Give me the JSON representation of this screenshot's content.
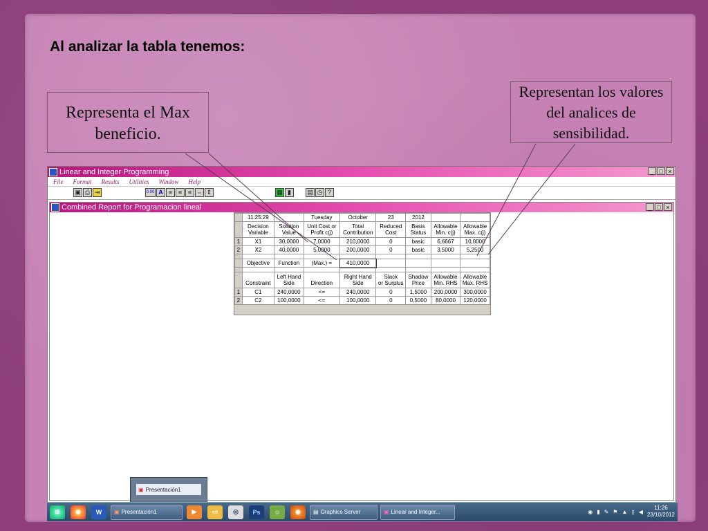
{
  "slide": {
    "title": "Al analizar la tabla tenemos:",
    "callout_left": "Representa el Max beneficio.",
    "callout_right": "Representan los valores del analices de sensibilidad."
  },
  "app": {
    "title": "Linear and Integer Programming",
    "menu": [
      "File",
      "Format",
      "Results",
      "Utilities",
      "Window",
      "Help"
    ],
    "toolbar": {
      "decimal_label": "0.00",
      "font_label": "A"
    },
    "child_title": "Combined Report for Programacion lineal"
  },
  "report": {
    "header_row": [
      "11:25:29",
      "",
      "Tuesday",
      "October",
      "23",
      "2012",
      "",
      ""
    ],
    "col_headers": [
      [
        "Decision",
        "Variable"
      ],
      [
        "Solution",
        "Value"
      ],
      [
        "Unit Cost or",
        "Profit c(j)"
      ],
      [
        "Total",
        "Contribution"
      ],
      [
        "Reduced",
        "Cost"
      ],
      [
        "Basis",
        "Status"
      ],
      [
        "Allowable",
        "Min. c(j)"
      ],
      [
        "Allowable",
        "Max. c(j)"
      ]
    ],
    "var_rows": [
      {
        "idx": "1",
        "cells": [
          "X1",
          "30,0000",
          "7,0000",
          "210,0000",
          "0",
          "basic",
          "6,6667",
          "10,0000"
        ]
      },
      {
        "idx": "2",
        "cells": [
          "X2",
          "40,0000",
          "5,0000",
          "200,0000",
          "0",
          "basic",
          "3,5000",
          "5,2500"
        ]
      }
    ],
    "objective_row": [
      "Objective",
      "Function",
      "(Max.) =",
      "410,0000"
    ],
    "con_headers": [
      [
        "",
        "Constraint"
      ],
      [
        "Left Hand",
        "Side"
      ],
      [
        "",
        "Direction"
      ],
      [
        "Right Hand",
        "Side"
      ],
      [
        "Slack",
        "or Surplus"
      ],
      [
        "Shadow",
        "Price"
      ],
      [
        "Allowable",
        "Min. RHS"
      ],
      [
        "Allowable",
        "Max. RHS"
      ]
    ],
    "con_rows": [
      {
        "idx": "1",
        "cells": [
          "C1",
          "240,0000",
          "<=",
          "240,0000",
          "0",
          "1,5000",
          "200,0000",
          "300,0000"
        ]
      },
      {
        "idx": "2",
        "cells": [
          "C2",
          "100,0000",
          "<=",
          "100,0000",
          "0",
          "0,5000",
          "80,0000",
          "120,0000"
        ]
      }
    ]
  },
  "taskbar": {
    "thumb_label": "Presentación1",
    "buttons": [
      "Presentación1",
      "Graphics Server",
      "Linear and Integer..."
    ],
    "clock_time": "11:26",
    "clock_date": "23/10/2012"
  },
  "colors": {
    "titlebar_accent": "#b8167c",
    "paper": "#c682b5",
    "frame": "#8e3f7c"
  }
}
